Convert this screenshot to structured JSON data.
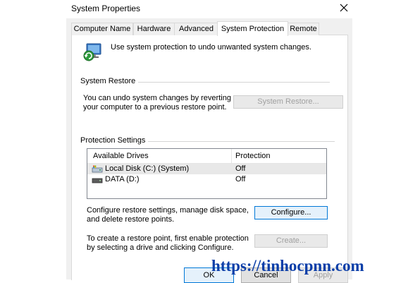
{
  "window": {
    "title": "System Properties"
  },
  "tabs": [
    {
      "label": "Computer Name"
    },
    {
      "label": "Hardware"
    },
    {
      "label": "Advanced"
    },
    {
      "label": "System Protection",
      "active": true
    },
    {
      "label": "Remote"
    }
  ],
  "intro": {
    "text": "Use system protection to undo unwanted system changes.",
    "icon": "system-protection-icon"
  },
  "system_restore": {
    "group_title": "System Restore",
    "description_line1": "You can undo system changes by reverting",
    "description_line2": "your computer to a previous restore point.",
    "button_label": "System Restore..."
  },
  "protection": {
    "group_title": "Protection Settings",
    "columns": [
      "Available Drives",
      "Protection"
    ],
    "drives": [
      {
        "name": "Local Disk (C:) (System)",
        "protection": "Off",
        "icon": "system-drive-icon",
        "selected": true
      },
      {
        "name": "DATA (D:)",
        "protection": "Off",
        "icon": "drive-icon",
        "selected": false
      }
    ],
    "configure_text_line1": "Configure restore settings, manage disk space,",
    "configure_text_line2": "and delete restore points.",
    "configure_label": "Configure...",
    "create_text_line1": "To create a restore point, first enable protection",
    "create_text_line2": "by selecting a drive and clicking Configure.",
    "create_label": "Create..."
  },
  "footer": {
    "ok_label": "OK",
    "cancel_label": "Cancel",
    "apply_label": "Apply"
  },
  "watermark": {
    "text": "https://tinhocpnn.com"
  },
  "colors": {
    "accent": "#0078d7",
    "watermark": "#0b3ea8"
  }
}
